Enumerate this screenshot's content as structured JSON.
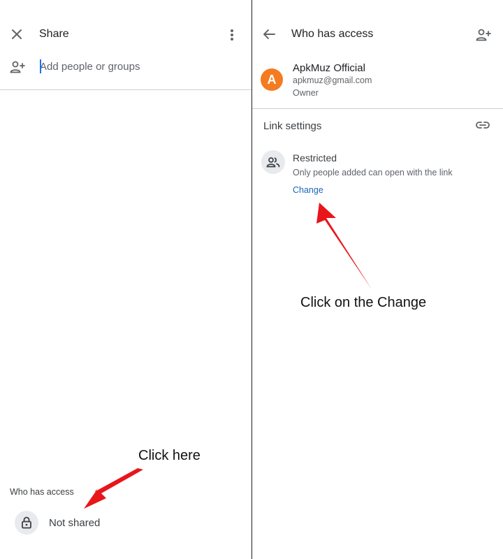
{
  "left_panel": {
    "header_title": "Share",
    "add_people_placeholder": "Add people or groups",
    "access_section_label": "Who has access",
    "access_status": "Not shared",
    "annotation": "Click here"
  },
  "right_panel": {
    "header_title": "Who has access",
    "owner": {
      "avatar_letter": "A",
      "name": "ApkMuz Official",
      "email": "apkmuz@gmail.com",
      "role": "Owner"
    },
    "link_settings_label": "Link settings",
    "restriction": {
      "title": "Restricted",
      "description": "Only people added can open with the link",
      "change_label": "Change"
    },
    "annotation": "Click on the Change"
  },
  "colors": {
    "accent_link": "#1a66b8",
    "avatar": "#f47b20",
    "arrow": "#e8151b",
    "icon_gray": "#5f6368"
  }
}
